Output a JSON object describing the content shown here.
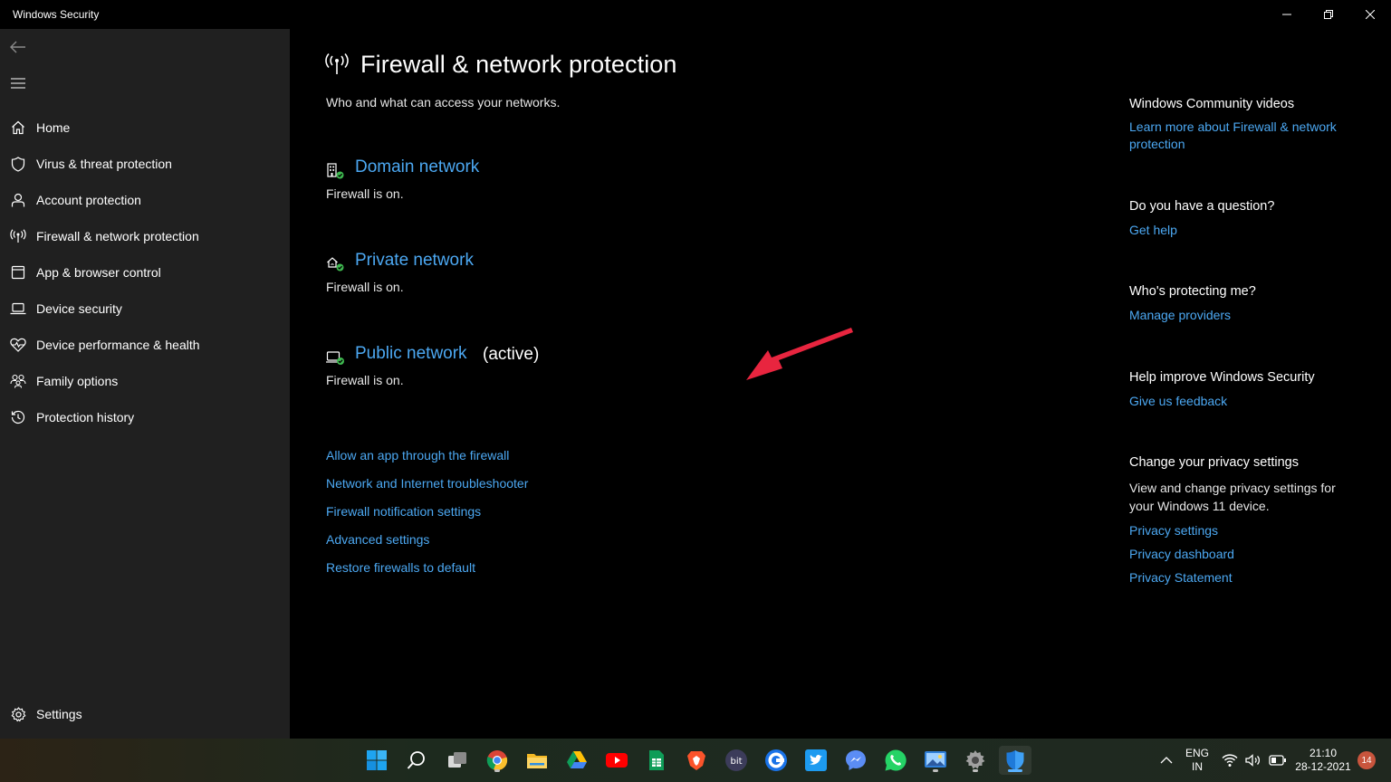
{
  "window": {
    "title": "Windows Security"
  },
  "sidebar": {
    "items": [
      {
        "label": "Home",
        "icon": "home-icon"
      },
      {
        "label": "Virus & threat protection",
        "icon": "shield-icon"
      },
      {
        "label": "Account protection",
        "icon": "person-icon"
      },
      {
        "label": "Firewall & network protection",
        "icon": "antenna-icon"
      },
      {
        "label": "App & browser control",
        "icon": "app-window-icon"
      },
      {
        "label": "Device security",
        "icon": "laptop-icon"
      },
      {
        "label": "Device performance & health",
        "icon": "heart-pulse-icon"
      },
      {
        "label": "Family options",
        "icon": "family-icon"
      },
      {
        "label": "Protection history",
        "icon": "history-icon"
      }
    ],
    "settings_label": "Settings"
  },
  "main": {
    "title": "Firewall & network protection",
    "subtitle": "Who and what can access your networks.",
    "networks": [
      {
        "name": "Domain network",
        "status": "Firewall is on.",
        "icon": "domain-network-icon",
        "active_label": ""
      },
      {
        "name": "Private network",
        "status": "Firewall is on.",
        "icon": "private-network-icon",
        "active_label": ""
      },
      {
        "name": "Public network",
        "status": "Firewall is on.",
        "icon": "public-network-icon",
        "active_label": "(active)"
      }
    ],
    "links": [
      "Allow an app through the firewall",
      "Network and Internet troubleshooter",
      "Firewall notification settings",
      "Advanced settings",
      "Restore firewalls to default"
    ]
  },
  "right": {
    "community": {
      "heading": "Windows Community videos",
      "link": "Learn more about Firewall & network protection"
    },
    "question": {
      "heading": "Do you have a question?",
      "link": "Get help"
    },
    "protecting": {
      "heading": "Who's protecting me?",
      "link": "Manage providers"
    },
    "improve": {
      "heading": "Help improve Windows Security",
      "link": "Give us feedback"
    },
    "privacy": {
      "heading": "Change your privacy settings",
      "text": "View and change privacy settings for your Windows 11 device.",
      "links": [
        "Privacy settings",
        "Privacy dashboard",
        "Privacy Statement"
      ]
    }
  },
  "taskbar": {
    "apps": [
      "windows-start",
      "search",
      "task-view",
      "chrome",
      "file-explorer",
      "google-drive",
      "youtube",
      "google-sheets",
      "brave",
      "bit-app",
      "cortana",
      "twitter",
      "messenger",
      "whatsapp",
      "photos",
      "settings",
      "windows-security"
    ],
    "tray": {
      "language": "ENG",
      "region": "IN",
      "time": "21:10",
      "date": "28-12-2021",
      "notifications": "14"
    }
  },
  "colors": {
    "link": "#4ca8f2",
    "sidebar_bg": "#202020",
    "main_bg": "#000000",
    "arrow": "#e8253f"
  }
}
